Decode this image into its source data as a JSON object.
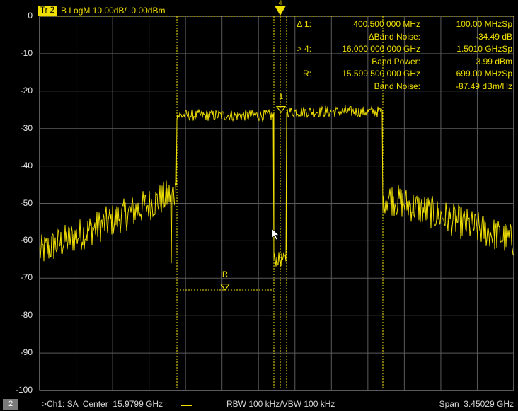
{
  "trace": {
    "tag": "Tr 2",
    "format": "B LogM 10.00dB/  0.00dBm",
    "color": "#f0e000"
  },
  "y_axis": {
    "labels": [
      "0",
      "-10",
      "-20",
      "-30",
      "-40",
      "-50",
      "-60",
      "-70",
      "-80",
      "-90",
      "-100"
    ]
  },
  "markers": {
    "marker_1_label": "1",
    "marker_4_label": "4",
    "reference_label": "R"
  },
  "readout": [
    {
      "key": "Δ 1:",
      "val1": "400.500 000  MHz",
      "val2": "100.00 MHzSp"
    },
    {
      "key": "",
      "val1": "ΔBand Noise:",
      "val2": "-34.49 dB"
    },
    {
      "key": "> 4:",
      "val1": "16.000 000 000 GHz",
      "val2": "1.5010 GHzSp"
    },
    {
      "key": "",
      "val1": "Band Power:",
      "val2": "3.99 dBm"
    },
    {
      "key": "R:",
      "val1": "15.599 500 000 GHz",
      "val2": "699.00 MHzSp"
    },
    {
      "key": "",
      "val1": "Band Noise:",
      "val2": "-87.49 dBm/Hz"
    }
  ],
  "status": {
    "channel_badge": "2",
    "channel": ">Ch1: SA  Center  15.9799 GHz",
    "rbw": "RBW 100 kHz/VBW 100 kHz",
    "span": "Span  3.45029 GHz"
  },
  "chart_data": {
    "type": "line",
    "ylim": [
      -100,
      0
    ],
    "y_unit": "dBm",
    "y_scale": "10.00 dB/div",
    "ref_level": "0.00 dBm",
    "center_ghz": 15.9799,
    "span_ghz": 3.45029,
    "segments": [
      {
        "name": "left-skirt",
        "x_div": [
          0.0,
          3.7
        ],
        "y_start_dbm": -63,
        "y_end_dbm": -47
      },
      {
        "name": "band-left",
        "x_div": [
          3.7,
          6.65
        ],
        "y_dbm": -26
      },
      {
        "name": "notch",
        "x_div": [
          6.65,
          7.0
        ],
        "y_dbm": -65
      },
      {
        "name": "band-right",
        "x_div": [
          7.0,
          9.4
        ],
        "y_dbm": -25.5
      },
      {
        "name": "right-skirt",
        "x_div": [
          9.4,
          13.0
        ],
        "y_start_dbm": -48,
        "y_end_dbm": -60
      }
    ],
    "grid": true
  }
}
